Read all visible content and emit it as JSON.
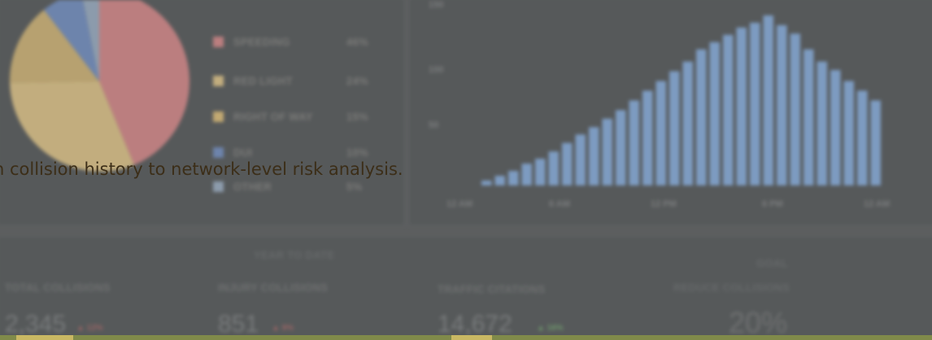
{
  "legend": [
    {
      "label": "SPEEDING",
      "pct": "46%",
      "color": "#c08081"
    },
    {
      "label": "RED LIGHT",
      "pct": "24%",
      "color": "#c8b280"
    },
    {
      "label": "RIGHT OF WAY",
      "pct": "15%",
      "color": "#c8ad73"
    },
    {
      "label": "DUI",
      "pct": "10%",
      "color": "#6e86b0"
    },
    {
      "label": "OTHER",
      "pct": "5%",
      "color": "#8f9fb0"
    }
  ],
  "chart": {
    "y_ticks": [
      "150",
      "100",
      "50"
    ],
    "x_ticks": [
      "12 AM",
      "6 AM",
      "12 PM",
      "6 PM",
      "12 AM"
    ],
    "bar_color": "#7f9fc7"
  },
  "chart_data": {
    "type": "bar",
    "ylim": [
      0,
      150
    ],
    "values": [
      4,
      8,
      12,
      18,
      22,
      28,
      35,
      42,
      48,
      55,
      62,
      70,
      78,
      86,
      94,
      102,
      112,
      118,
      124,
      130,
      134,
      140,
      132,
      125,
      112,
      102,
      95,
      86,
      78,
      70
    ]
  },
  "kpis": {
    "ytd_header": "YEAR TO DATE",
    "goal_header": "GOAL",
    "items": [
      {
        "label": "TOTAL COLLISIONS",
        "value": "2,345",
        "delta": "▲ 12%",
        "delta_color": "#9d6565"
      },
      {
        "label": "INJURY COLLISIONS",
        "value": "851",
        "delta": "▲ 9%",
        "delta_color": "#9d6565"
      },
      {
        "label": "TRAFFIC CITATIONS",
        "value": "14,672",
        "delta": "▲ 16%",
        "delta_color": "#6f9a6c"
      },
      {
        "label": "REDUCE COLLISIONS",
        "value": "20%",
        "delta": "",
        "delta_color": "#7a7d7e"
      }
    ]
  },
  "caption": "n collision history to network-level risk analysis.",
  "colors": {
    "accent_bar": "#808a4a",
    "bar_highlight": "#c9b863"
  }
}
